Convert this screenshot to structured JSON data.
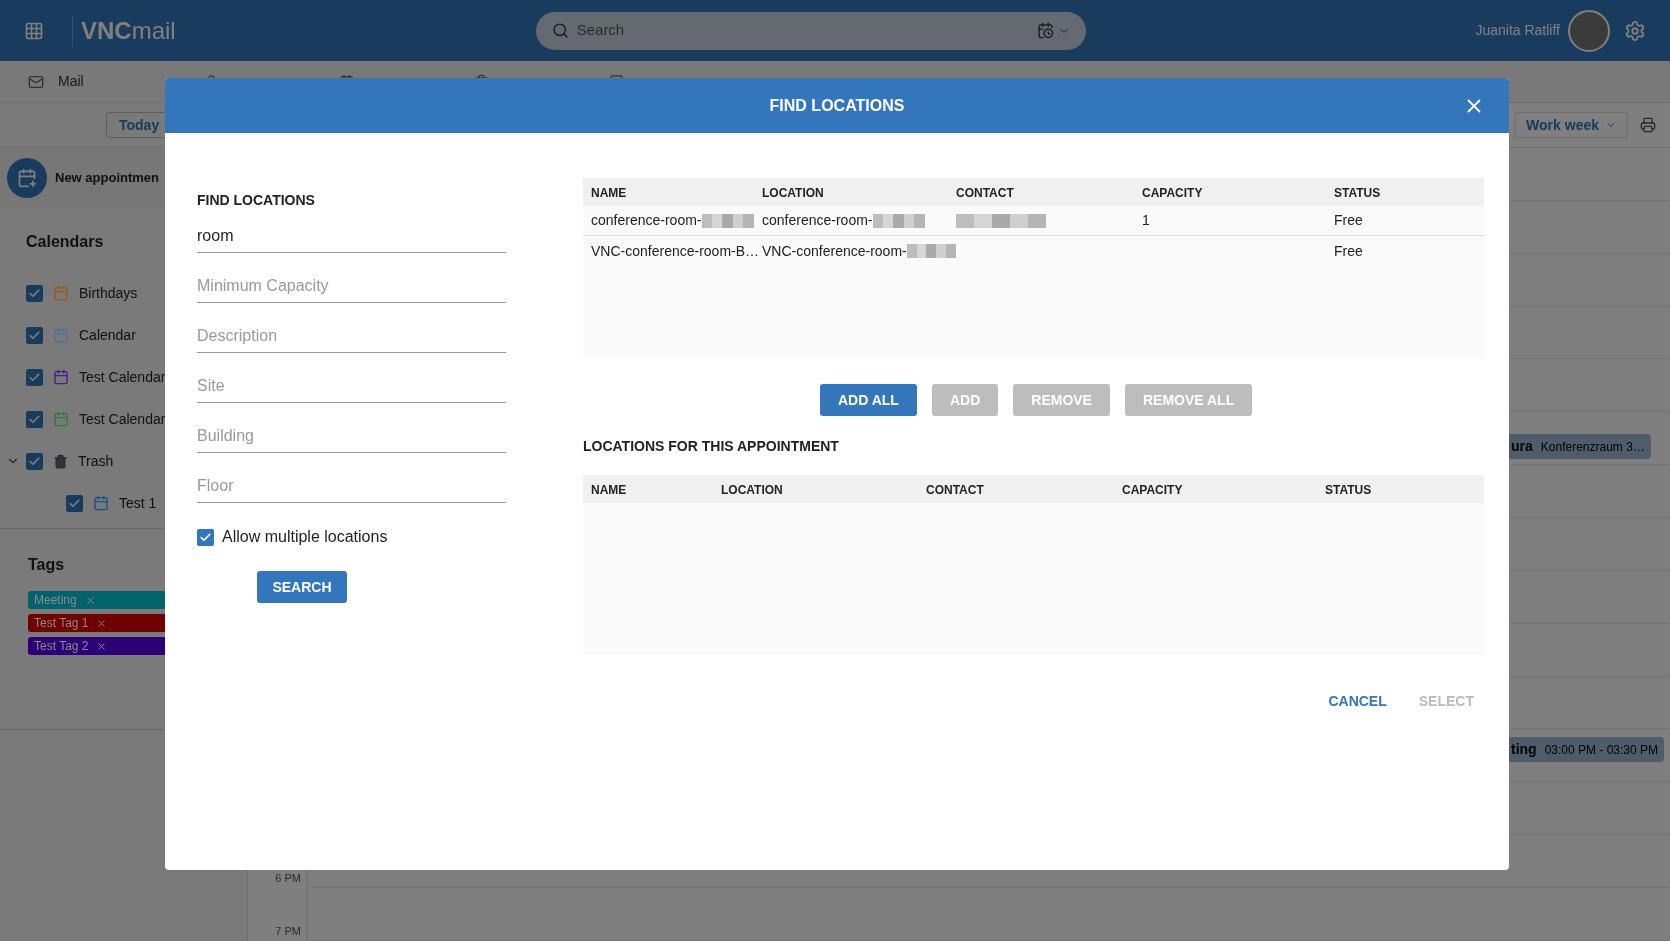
{
  "topbar": {
    "logo": "**VNC**mail",
    "search": {
      "placeholder": "Search"
    },
    "user_name": "Juanita Ratliff"
  },
  "nav_tabs": [
    {
      "label": "Mail"
    }
  ],
  "toolbar": {
    "today_button": "Today",
    "view_select": "Work week"
  },
  "sidebar": {
    "new_appointment": "New appointmen",
    "calendars_heading": "Calendars",
    "calendars": [
      {
        "kind": "calendar",
        "label": "Birthdays",
        "checked": true,
        "color": "#9a5a1c"
      },
      {
        "kind": "calendar",
        "label": "Calendar",
        "checked": true,
        "color": "#4a72a0"
      },
      {
        "kind": "calendar",
        "label": "Test Calendar",
        "checked": true,
        "color": "#4a1a90"
      },
      {
        "kind": "calendar",
        "label": "Test Calendar",
        "checked": true,
        "color": "#2f7a36"
      },
      {
        "kind": "trash",
        "label": "Trash",
        "checked": true,
        "expanded": true,
        "children": [
          {
            "kind": "calendar",
            "label": "Test 1",
            "checked": true,
            "color": "#1f4f7e"
          }
        ]
      }
    ],
    "tags_heading": "Tags",
    "tags": [
      {
        "label": "Meeting",
        "color": "#02626e"
      },
      {
        "label": "Test Tag 1",
        "color": "#700000"
      },
      {
        "label": "Test Tag 2",
        "color": "#2e0078"
      }
    ]
  },
  "calendar": {
    "events": [
      {
        "title": "ura",
        "detail": "Konferenzraum 3…"
      },
      {
        "title": "ting",
        "detail": "03:00 PM - 03:30 PM"
      }
    ],
    "time_labels": [
      "6 PM",
      "7 PM"
    ]
  },
  "dialog": {
    "title": "FIND LOCATIONS",
    "form_heading": "FIND LOCATIONS",
    "fields": [
      {
        "value": "room"
      },
      {
        "placeholder": "Minimum Capacity"
      },
      {
        "placeholder": "Description"
      },
      {
        "placeholder": "Site"
      },
      {
        "placeholder": "Building"
      },
      {
        "placeholder": "Floor"
      }
    ],
    "allow_multiple": {
      "label": "Allow multiple locations",
      "checked": true
    },
    "search_button": "SEARCH",
    "results": {
      "columns": [
        "NAME",
        "LOCATION",
        "CONTACT",
        "CAPACITY",
        "STATUS"
      ],
      "rows": [
        {
          "name": "conference-room-",
          "name_redacted": true,
          "location": "conference-room-",
          "location_redacted": true,
          "contact_redacted": true,
          "capacity": "1",
          "status": "Free"
        },
        {
          "name": "VNC-conference-room-B…",
          "name_redacted": false,
          "location": "VNC-conference-room-",
          "location_redacted": true,
          "contact_redacted": false,
          "status": "Free"
        }
      ]
    },
    "actions": [
      {
        "label": "ADD ALL",
        "disabled": false
      },
      {
        "label": "ADD",
        "disabled": true
      },
      {
        "label": "REMOVE",
        "disabled": true
      },
      {
        "label": "REMOVE ALL",
        "disabled": true
      }
    ],
    "selected_heading": "LOCATIONS FOR THIS APPOINTMENT",
    "selected": {
      "columns": [
        "NAME",
        "LOCATION",
        "CONTACT",
        "CAPACITY",
        "STATUS"
      ]
    },
    "footer": [
      {
        "label": "CANCEL",
        "disabled": false
      },
      {
        "label": "SELECT",
        "disabled": true
      }
    ]
  }
}
